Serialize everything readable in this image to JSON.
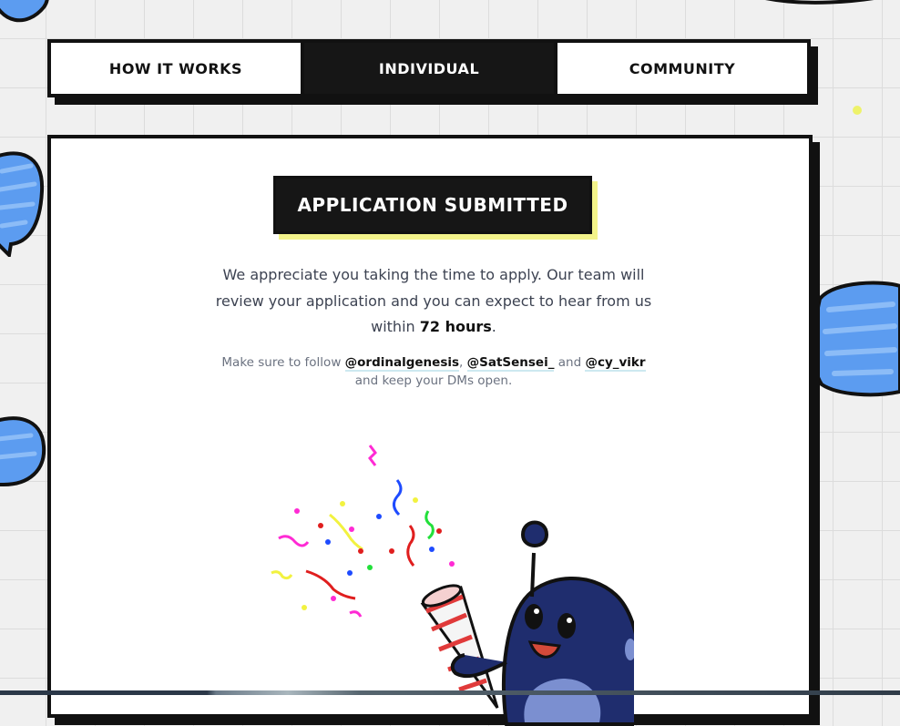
{
  "tabs": [
    {
      "label": "HOW IT WORKS",
      "active": false
    },
    {
      "label": "INDIVIDUAL",
      "active": true
    },
    {
      "label": "COMMUNITY",
      "active": false
    }
  ],
  "card": {
    "badge": "APPLICATION SUBMITTED",
    "message_main": "We appreciate you taking the time to apply. Our team will review your application and you can expect to hear from us within ",
    "message_emphasis": "72 hours",
    "message_end": ".",
    "follow_prefix": "Make sure to follow ",
    "handles": [
      "@ordinalgenesis",
      "@SatSensei_",
      "@cy_vikr"
    ],
    "comma": ", ",
    "and_word": " and ",
    "follow_suffix": "and keep your DMs open."
  },
  "icons": {
    "illustration": "party-popper-mascot-icon",
    "bubbles": "speech-bubble-icon"
  },
  "colors": {
    "dark": "#161616",
    "badge_shadow": "#f3f38a",
    "bubble_blue": "#5c9cf0",
    "mascot": "#1f2d6e"
  }
}
